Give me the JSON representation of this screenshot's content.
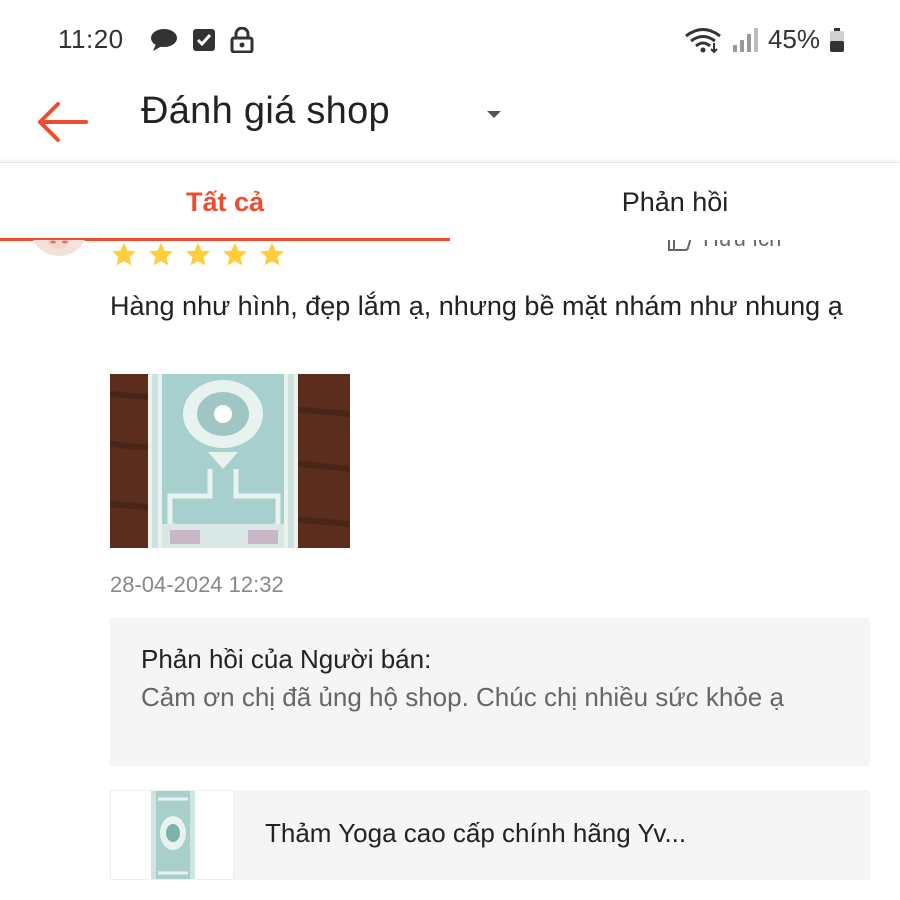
{
  "status_bar": {
    "time": "11:20",
    "battery_percent": "45%",
    "icons_left": [
      "chat-bubble-icon",
      "checkbox-icon",
      "lock-icon"
    ],
    "icons_right": [
      "wifi-icon",
      "signal-icon",
      "battery-icon"
    ]
  },
  "header": {
    "title": "Đánh giá shop",
    "back_icon": "back-arrow-icon",
    "caret_icon": "caret-down-icon",
    "accent_color": "#ee4d2d"
  },
  "tabs": [
    {
      "label": "Tất cả",
      "active": true
    },
    {
      "label": "Phản hồi",
      "active": false
    }
  ],
  "review": {
    "rating": 5,
    "helpful_label": "Hữu ích",
    "more_label": "•••",
    "text": "Hàng như hình, đẹp lắm ạ, nhưng bề mặt nhám như nhung ạ",
    "timestamp": "28-04-2024 12:32",
    "star_color": "#ffce3d"
  },
  "seller_reply": {
    "title": "Phản hồi của Người bán:",
    "text": "Cảm ơn chị đã ủng hộ shop. Chúc chị nhiều sức khỏe ạ"
  },
  "product": {
    "name": "Thảm Yoga cao cấp chính hãng Yv..."
  }
}
